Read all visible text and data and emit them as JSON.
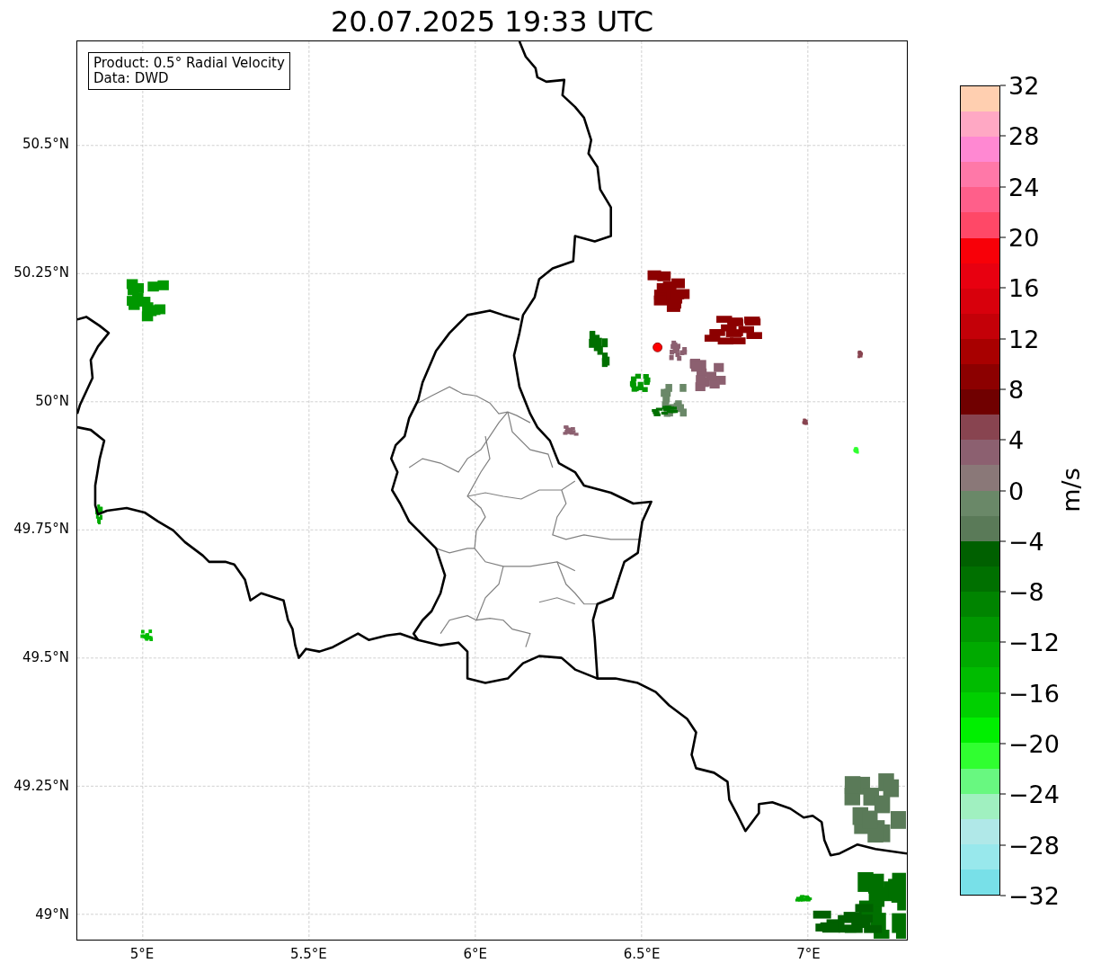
{
  "title": "20.07.2025 19:33 UTC",
  "legend": [
    "Product: 0.5° Radial Velocity",
    "Data: DWD"
  ],
  "map": {
    "y_ticks": [
      "50.5°N",
      "50.25°N",
      "50°N",
      "49.75°N",
      "49.5°N",
      "49.25°N",
      "49°N"
    ],
    "x_ticks": [
      "5°E",
      "5.5°E",
      "6°E",
      "6.5°E",
      "7°E"
    ]
  },
  "colorbar": {
    "label": "m/s",
    "ticks": [
      "32",
      "28",
      "24",
      "20",
      "16",
      "12",
      "8",
      "4",
      "0",
      "−4",
      "−8",
      "−12",
      "−16",
      "−20",
      "−24",
      "−28",
      "−32"
    ],
    "segments": [
      {
        "color": "#ffcfb0"
      },
      {
        "color": "#ffa8c4"
      },
      {
        "color": "#ff88d2"
      },
      {
        "color": "#ff78a8"
      },
      {
        "color": "#ff5f8a"
      },
      {
        "color": "#ff4867"
      },
      {
        "color": "#f80008"
      },
      {
        "color": "#e80010"
      },
      {
        "color": "#d8000c"
      },
      {
        "color": "#c40008"
      },
      {
        "color": "#a80000"
      },
      {
        "color": "#8c0000"
      },
      {
        "color": "#700000"
      },
      {
        "color": "#884450"
      },
      {
        "color": "#8c6070"
      },
      {
        "color": "#8a7878"
      },
      {
        "color": "#6a8868"
      },
      {
        "color": "#5a7a58"
      },
      {
        "color": "#006000"
      },
      {
        "color": "#007000"
      },
      {
        "color": "#008400"
      },
      {
        "color": "#009800"
      },
      {
        "color": "#00aa00"
      },
      {
        "color": "#00bc00"
      },
      {
        "color": "#00d000"
      },
      {
        "color": "#00f000"
      },
      {
        "color": "#30ff30"
      },
      {
        "color": "#68f880"
      },
      {
        "color": "#a0f0c0"
      },
      {
        "color": "#b0e8e8"
      },
      {
        "color": "#98e8ec"
      },
      {
        "color": "#78e0e8"
      }
    ]
  }
}
